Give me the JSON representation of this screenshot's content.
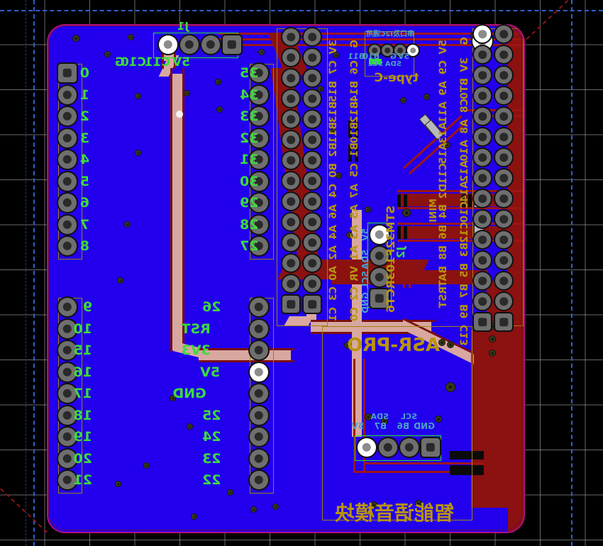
{
  "app": {
    "view": "pcb-layout-editor",
    "layer_view": "bottom-mirrored",
    "board_name": "ASR-PRO voice module carrier board"
  },
  "colors": {
    "background": "#000000",
    "grid": "#bebebe",
    "board_fill": "#2200ee",
    "board_edge": "#b0107a",
    "copper_track": "#9e1515",
    "copper_pour": "#8c1111",
    "track_highlight": "#d8a8a0",
    "silkscreen_yellow": "#b8940f",
    "silkscreen_green": "#3ddb3d",
    "silkscreen_cyan": "#4aa0c8",
    "pad_ring": "#6f6f6f",
    "pad_hole": "#2a2a2a",
    "pad_selected": "#ffffff",
    "courtyard": "#a08010",
    "guide_blue": "#2f5fd0",
    "guide_red": "#8b1616"
  },
  "board": {
    "silk_labels": {
      "mcu": "STM32F103RCT6",
      "usb": "type-C",
      "module": "ASR-PRO",
      "module_cn": "智能语音模块",
      "mini": "MINI",
      "uart_i2c_note_cn": "串口及I2C通用"
    }
  },
  "connectors": {
    "j1": {
      "ref": "J1",
      "pins": [
        "5V",
        "C11",
        "C10",
        "G"
      ]
    },
    "j2": {
      "ref": "J2",
      "pins": [
        "5V",
        "SDA",
        "SCL",
        "GND"
      ]
    },
    "uart_i2c_header": {
      "ref": "",
      "pins": [
        "5V",
        "G",
        "B10",
        "B11"
      ],
      "alt_pins": [
        "SCL",
        "SDA"
      ]
    },
    "asr_header": {
      "ref": "",
      "pins": [
        "5V",
        "B7",
        "B6",
        "GND"
      ],
      "alt_pins": [
        "SDA",
        "SCL"
      ]
    }
  },
  "headers": {
    "left_top": {
      "name": "left-top-numeric-header",
      "labels": [
        "0",
        "1",
        "2",
        "3",
        "4",
        "5",
        "6",
        "7",
        "8"
      ]
    },
    "left_bottom": {
      "name": "left-bottom-numeric-header",
      "labels": [
        "9",
        "10",
        "15",
        "16",
        "17",
        "18",
        "19",
        "20",
        "21"
      ]
    },
    "mid_top": {
      "name": "mid-top-numeric-header",
      "labels": [
        "35",
        "34",
        "33",
        "32",
        "31",
        "30",
        "29",
        "28",
        "27"
      ]
    },
    "mid_bottom": {
      "name": "mid-bottom-power-header",
      "labels": [
        "26",
        "RST",
        "3V3",
        "5V",
        "GND",
        "25",
        "24",
        "23",
        "22"
      ]
    },
    "mcu_left_outer": {
      "name": "mcu-left-outer-pin-column",
      "labels": [
        "3V",
        "C7",
        "B15",
        "B13",
        "B11",
        "B2",
        "B0",
        "C4",
        "A6",
        "A4",
        "A2",
        "A0",
        "C3",
        "C1"
      ]
    },
    "mcu_left_inner": {
      "name": "mcu-left-inner-pin-column",
      "labels": [
        "G",
        "C6",
        "B14",
        "B12",
        "B10",
        "B1",
        "C5",
        "A7",
        "A5",
        "A3",
        "A1",
        "VR",
        "C2",
        "C0"
      ]
    },
    "mcu_right_inner": {
      "name": "mcu-right-inner-pin-column",
      "labels": [
        "5V",
        "C9",
        "A9",
        "A11",
        "A13",
        "A15",
        "C11",
        "D2",
        "B4",
        "B6",
        "B8",
        "BAT",
        "RST"
      ]
    },
    "mcu_right_outer": {
      "name": "mcu-right-outer-pin-column",
      "labels": [
        "G",
        "3V",
        "BT0",
        "C8",
        "A8",
        "A10",
        "A12",
        "A14",
        "C10",
        "C12",
        "B3",
        "B5",
        "B7",
        "B9",
        "C13"
      ]
    }
  },
  "chart_data": null
}
